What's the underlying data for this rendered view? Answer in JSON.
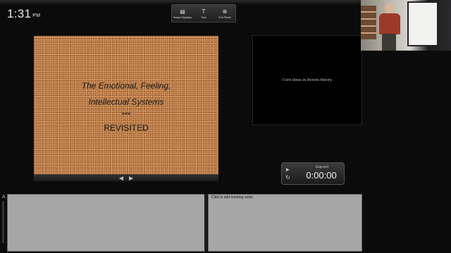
{
  "clock": {
    "time": "1:31",
    "ampm": "PM"
  },
  "toolbar": {
    "swap_displays_label": "Swap Displays",
    "tips_label": "Tips",
    "exit_show_label": "Exit Show"
  },
  "current_slide": {
    "line1": "The Emotional, Feeling,",
    "line2": "Intellectual Systems",
    "stars": "***",
    "line4": "REVISITED",
    "background_color": "#c98a55"
  },
  "next_slide": {
    "text": "Core ideas in Bowen theory"
  },
  "timer": {
    "label": "Elapsed",
    "value": "0:00:00"
  },
  "notes": {
    "placeholder": "Click to add meeting notes"
  },
  "icons": {
    "swap": "swap-displays-icon",
    "tips": "tips-icon",
    "exit": "exit-icon",
    "prev": "arrow-left-icon",
    "next": "arrow-right-icon",
    "play": "play-icon",
    "reset": "reset-icon"
  }
}
